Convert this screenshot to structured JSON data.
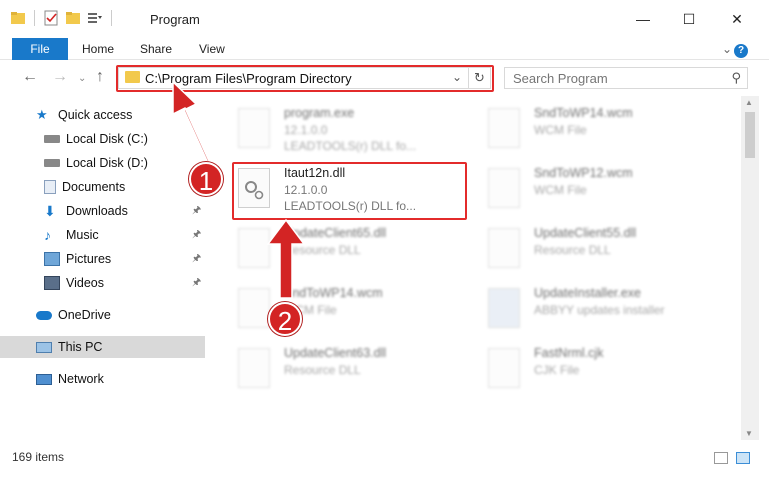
{
  "window": {
    "title": "Program",
    "minimize_icon": "minimize-icon",
    "maximize_icon": "maximize-icon",
    "close_icon": "close-icon"
  },
  "ribbon": {
    "tabs": [
      "File",
      "Home",
      "Share",
      "View"
    ]
  },
  "address": {
    "path": "C:\\Program Files\\Program Directory",
    "search_placeholder": "Search Program"
  },
  "nav": {
    "items": [
      {
        "label": "Quick access",
        "icon": "star-icon"
      },
      {
        "label": "Local Disk (C:)",
        "icon": "drive-icon"
      },
      {
        "label": "Local Disk (D:)",
        "icon": "drive-icon"
      },
      {
        "label": "Documents",
        "icon": "documents-icon"
      },
      {
        "label": "Downloads",
        "icon": "downloads-icon"
      },
      {
        "label": "Music",
        "icon": "music-icon"
      },
      {
        "label": "Pictures",
        "icon": "pictures-icon"
      },
      {
        "label": "Videos",
        "icon": "videos-icon"
      },
      {
        "label": "OneDrive",
        "icon": "cloud-icon"
      },
      {
        "label": "This PC",
        "icon": "computer-icon"
      },
      {
        "label": "Network",
        "icon": "network-icon"
      }
    ]
  },
  "files": [
    {
      "name": "program.exe",
      "type": "12.1.0.0",
      "extra": "LEADTOOLS(r) DLL fo..."
    },
    {
      "name": "SndToWP14.wcm",
      "type": "WCM File",
      "extra": ""
    },
    {
      "name": "Itaut12n.dll",
      "type": "12.1.0.0",
      "extra": "LEADTOOLS(r) DLL fo..."
    },
    {
      "name": "SndToWP12.wcm",
      "type": "WCM File",
      "extra": ""
    },
    {
      "name": "UpdateClient65.dll",
      "type": "Resource DLL",
      "extra": ""
    },
    {
      "name": "UpdateClient55.dll",
      "type": "Resource DLL",
      "extra": ""
    },
    {
      "name": "SndToWP14.wcm",
      "type": "WCM File",
      "extra": ""
    },
    {
      "name": "UpdateInstaller.exe",
      "type": "ABBYY updates installer",
      "extra": ""
    },
    {
      "name": "UpdateClient63.dll",
      "type": "Resource DLL",
      "extra": ""
    },
    {
      "name": "FastNrml.cjk",
      "type": "CJK File",
      "extra": ""
    }
  ],
  "status": {
    "item_count": "169 items"
  },
  "annotations": {
    "badge_1": "1",
    "badge_2": "2",
    "color": "#d32424"
  }
}
